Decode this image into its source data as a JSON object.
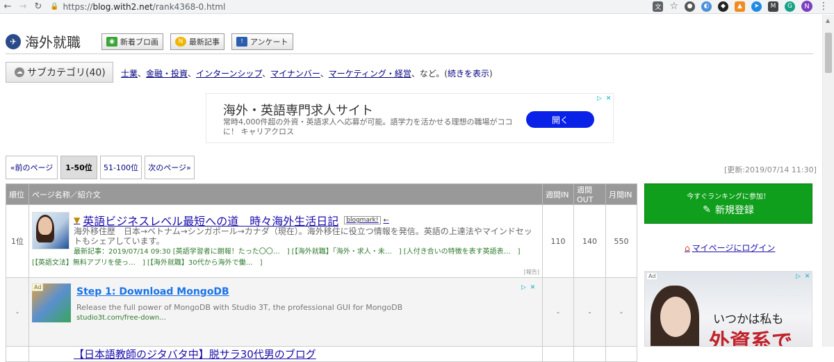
{
  "browser": {
    "url_protocol": "https://",
    "url_host": "blog.with2.net",
    "url_path": "/rank4368-0.html",
    "profile_initial": "N"
  },
  "header": {
    "site_title": "海外就職",
    "buttons": [
      "新着ブロ画",
      "最新記事",
      "アンケート"
    ]
  },
  "subcategory": {
    "button_label": "サブカテゴリ(40)",
    "links": [
      "士業",
      "金融・投資",
      "インターンシップ",
      "マイナンバー",
      "マーケティング・経営"
    ],
    "suffix": "など。(",
    "more_label": "続きを表示",
    "close": ")"
  },
  "banner_ad": {
    "title": "海外・英語専門求人サイト",
    "description": "常時4,000件超の外資・英語求人へ応募が可能。語学力を活かせる理想の職場がココに！ キャリアクロス",
    "button": "開く"
  },
  "pager": {
    "prev": "«前のページ",
    "current": "1-50位",
    "next_range": "51-100位",
    "next": "次のページ»"
  },
  "updated": "[更新:2019/07/14 11:30]",
  "table": {
    "headers": [
      "順位",
      "ページ名称／紹介文",
      "週間IN",
      "週間OUT",
      "月間IN"
    ],
    "row1": {
      "rank": "1位",
      "title": "英語ビジネスレベル最短への道　時々海外生活日記",
      "blogmark": "blogmark!",
      "arrow": "←",
      "description": "海外移住歴　日本→ベトナム→シンガポール→カナダ（現在）。海外移住に役立つ情報を発信。英語の上達法やマインドセットもシェアしています。",
      "latest": "最新記事：2019/07/14 09:30 [英語学習者に朗報！たった〇〇…　] [【海外就職】「海外・求人・未…　] [人付き合いの特徴を表す英語表…　]",
      "more": "[【英語文法】無料アプリを使っ…　] [【海外就職】30代から海外で働…　]",
      "week_in": "110",
      "week_out": "140",
      "month_in": "550",
      "report": "[報告]"
    },
    "row2": {
      "rank": "-",
      "ad_tag": "Ad",
      "title": "Step 1: Download MongoDB",
      "body": "Release the full power of MongoDB with Studio 3T, the professional GUI for MongoDB",
      "url": "studio3t.com/free-down...",
      "week_in": "-",
      "week_out": "-",
      "month_in": "-"
    },
    "row3": {
      "title": "【日本語教師のジタバタ中】脱サラ30代男のブログ"
    }
  },
  "sidebar": {
    "join_small": "今すぐランキングに参加！",
    "join_big": "新規登録",
    "mypage": "マイページにログイン",
    "ad": {
      "tag": "Ad",
      "line1": "いつかは私も",
      "line2": "外資系で"
    }
  }
}
